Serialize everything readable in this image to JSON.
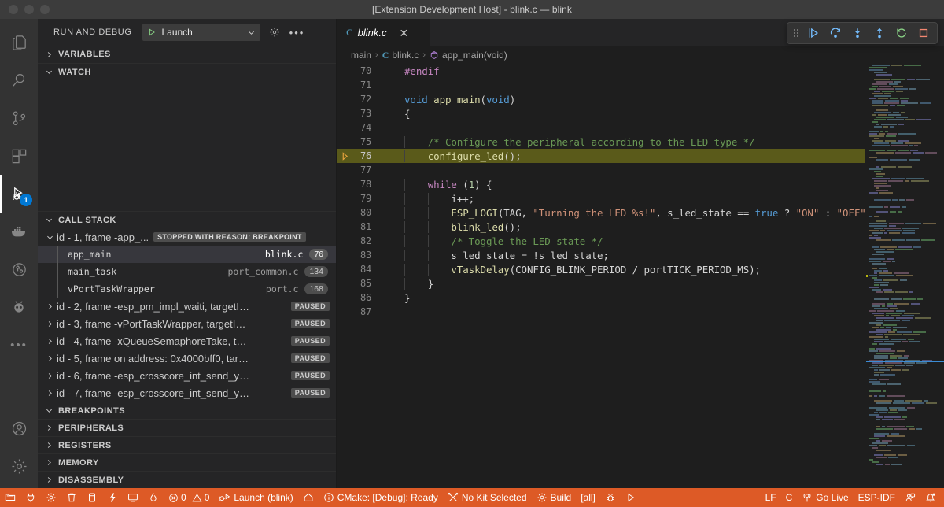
{
  "window": {
    "title": "[Extension Development Host] - blink.c — blink",
    "traffic_lights": [
      "close",
      "minimize",
      "zoom"
    ]
  },
  "activity_bar": {
    "items": [
      {
        "name": "explorer",
        "icon": "files-icon",
        "active": false
      },
      {
        "name": "search",
        "icon": "search-icon",
        "active": false
      },
      {
        "name": "source-control",
        "icon": "source-control-icon",
        "active": false
      },
      {
        "name": "extensions",
        "icon": "extensions-icon",
        "active": false
      },
      {
        "name": "run-and-debug",
        "icon": "debug-icon",
        "active": true,
        "badge": "1"
      },
      {
        "name": "docker",
        "icon": "docker-icon",
        "active": false
      },
      {
        "name": "testing",
        "icon": "beaker-icon",
        "active": false
      },
      {
        "name": "espressif",
        "icon": "ant-icon",
        "active": false
      },
      {
        "name": "more-views",
        "icon": "ellipsis-icon",
        "active": false
      }
    ],
    "bottom_items": [
      {
        "name": "accounts",
        "icon": "account-icon"
      },
      {
        "name": "manage",
        "icon": "gear-icon"
      }
    ]
  },
  "sidebar": {
    "header": {
      "title": "RUN AND DEBUG",
      "launch_config": "Launch",
      "play_icon": "play-icon",
      "chevron_icon": "chevron-down-icon",
      "settings_icon": "gear-icon",
      "more_icon": "ellipsis-icon"
    },
    "sections": [
      {
        "name": "variables",
        "label": "VARIABLES",
        "expanded": false
      },
      {
        "name": "watch",
        "label": "WATCH",
        "expanded": true
      },
      {
        "name": "call-stack",
        "label": "CALL STACK",
        "expanded": true
      }
    ],
    "bottom_sections": [
      {
        "name": "breakpoints",
        "label": "BREAKPOINTS",
        "expanded": true
      },
      {
        "name": "peripherals",
        "label": "PERIPHERALS",
        "expanded": false
      },
      {
        "name": "registers",
        "label": "REGISTERS",
        "expanded": false
      },
      {
        "name": "memory",
        "label": "MEMORY",
        "expanded": false
      },
      {
        "name": "disassembly",
        "label": "DISASSEMBLY",
        "expanded": false
      }
    ],
    "call_stack": {
      "threads": [
        {
          "label": "id - 1, frame -app_...",
          "expanded": true,
          "badge": "STOPPED WITH REASON: BREAKPOINT",
          "frames": [
            {
              "name": "app_main",
              "file": "blink.c",
              "line": "76",
              "selected": true
            },
            {
              "name": "main_task",
              "file": "port_common.c",
              "line": "134",
              "selected": false
            },
            {
              "name": "vPortTaskWrapper",
              "file": "port.c",
              "line": "168",
              "selected": false
            }
          ]
        },
        {
          "label": "id - 2, frame -esp_pm_impl_waiti, targetID - ...",
          "expanded": false,
          "badge": "PAUSED",
          "frames": []
        },
        {
          "label": "id - 3, frame -vPortTaskWrapper, targetID - ...",
          "expanded": false,
          "badge": "PAUSED",
          "frames": []
        },
        {
          "label": "id - 4, frame -xQueueSemaphoreTake, target...",
          "expanded": false,
          "badge": "PAUSED",
          "frames": []
        },
        {
          "label": "id - 5, frame on address: 0x4000bff0, target...",
          "expanded": false,
          "badge": "PAUSED",
          "frames": []
        },
        {
          "label": "id - 6, frame -esp_crosscore_int_send_yield, ...",
          "expanded": false,
          "badge": "PAUSED",
          "frames": []
        },
        {
          "label": "id - 7, frame -esp_crosscore_int_send_yield, t...",
          "expanded": false,
          "badge": "PAUSED",
          "frames": []
        }
      ]
    }
  },
  "editor": {
    "tab": {
      "lang_badge": "C",
      "name": "blink.c",
      "close_icon": "close-icon",
      "dirty": false
    },
    "breadcrumb": [
      {
        "label": "main",
        "icon": ""
      },
      {
        "label": "blink.c",
        "icon": "c-file-icon"
      },
      {
        "label": "app_main(void)",
        "icon": "symbol-method-icon"
      }
    ],
    "debug_toolbar": [
      {
        "name": "drag-handle",
        "icon": "grip-icon",
        "color": "#8a8a8a"
      },
      {
        "name": "continue",
        "icon": "continue-icon",
        "color": "#75beff"
      },
      {
        "name": "step-over",
        "icon": "step-over-icon",
        "color": "#75beff"
      },
      {
        "name": "step-into",
        "icon": "step-into-icon",
        "color": "#75beff"
      },
      {
        "name": "step-out",
        "icon": "step-out-icon",
        "color": "#75beff"
      },
      {
        "name": "restart",
        "icon": "restart-icon",
        "color": "#89d185"
      },
      {
        "name": "stop",
        "icon": "stop-icon",
        "color": "#f48771"
      }
    ],
    "breakpoint_line": 76,
    "current_line": 76,
    "first_line": 70,
    "lines": [
      {
        "no": 70,
        "indent": 0,
        "tokens": [
          {
            "t": "#endif",
            "c": "tk-pp"
          }
        ]
      },
      {
        "no": 71,
        "indent": 0,
        "tokens": []
      },
      {
        "no": 72,
        "indent": 0,
        "tokens": [
          {
            "t": "void",
            "c": "tk-type"
          },
          {
            "t": " ",
            "c": "tk-pl"
          },
          {
            "t": "app_main",
            "c": "tk-fn"
          },
          {
            "t": "(",
            "c": "tk-pl"
          },
          {
            "t": "void",
            "c": "tk-type"
          },
          {
            "t": ")",
            "c": "tk-pl"
          }
        ]
      },
      {
        "no": 73,
        "indent": 0,
        "tokens": [
          {
            "t": "{",
            "c": "tk-pl"
          }
        ]
      },
      {
        "no": 74,
        "indent": 1,
        "tokens": []
      },
      {
        "no": 75,
        "indent": 1,
        "tokens": [
          {
            "t": "    /* Configure the peripheral according to the LED type */",
            "c": "tk-cm"
          }
        ]
      },
      {
        "no": 76,
        "indent": 1,
        "tokens": [
          {
            "t": "    ",
            "c": "tk-pl"
          },
          {
            "t": "configure_led",
            "c": "tk-fn"
          },
          {
            "t": "();",
            "c": "tk-pl"
          }
        ]
      },
      {
        "no": 77,
        "indent": 1,
        "tokens": []
      },
      {
        "no": 78,
        "indent": 1,
        "tokens": [
          {
            "t": "    ",
            "c": "tk-pl"
          },
          {
            "t": "while",
            "c": "tk-kw"
          },
          {
            "t": " (",
            "c": "tk-pl"
          },
          {
            "t": "1",
            "c": "tk-num"
          },
          {
            "t": ") {",
            "c": "tk-pl"
          }
        ]
      },
      {
        "no": 79,
        "indent": 2,
        "tokens": [
          {
            "t": "        i++;",
            "c": "tk-pl"
          }
        ]
      },
      {
        "no": 80,
        "indent": 2,
        "tokens": [
          {
            "t": "        ",
            "c": "tk-pl"
          },
          {
            "t": "ESP_LOGI",
            "c": "tk-fn"
          },
          {
            "t": "(TAG, ",
            "c": "tk-pl"
          },
          {
            "t": "\"Turning the LED %s!\"",
            "c": "tk-str"
          },
          {
            "t": ", s_led_state == ",
            "c": "tk-pl"
          },
          {
            "t": "true",
            "c": "tk-type"
          },
          {
            "t": " ? ",
            "c": "tk-pl"
          },
          {
            "t": "\"ON\"",
            "c": "tk-str"
          },
          {
            "t": " : ",
            "c": "tk-pl"
          },
          {
            "t": "\"OFF\"",
            "c": "tk-str"
          },
          {
            "t": ");",
            "c": "tk-pl"
          }
        ]
      },
      {
        "no": 81,
        "indent": 2,
        "tokens": [
          {
            "t": "        ",
            "c": "tk-pl"
          },
          {
            "t": "blink_led",
            "c": "tk-fn"
          },
          {
            "t": "();",
            "c": "tk-pl"
          }
        ]
      },
      {
        "no": 82,
        "indent": 2,
        "tokens": [
          {
            "t": "        /* Toggle the LED state */",
            "c": "tk-cm"
          }
        ]
      },
      {
        "no": 83,
        "indent": 2,
        "tokens": [
          {
            "t": "        s_led_state = !s_led_state;",
            "c": "tk-pl"
          }
        ]
      },
      {
        "no": 84,
        "indent": 2,
        "tokens": [
          {
            "t": "        ",
            "c": "tk-pl"
          },
          {
            "t": "vTaskDelay",
            "c": "tk-fn"
          },
          {
            "t": "(CONFIG_BLINK_PERIOD / portTICK_PERIOD_MS);",
            "c": "tk-pl"
          }
        ]
      },
      {
        "no": 85,
        "indent": 1,
        "tokens": [
          {
            "t": "    }",
            "c": "tk-pl"
          }
        ]
      },
      {
        "no": 86,
        "indent": 0,
        "tokens": [
          {
            "t": "}",
            "c": "tk-pl"
          }
        ]
      },
      {
        "no": 87,
        "indent": 0,
        "tokens": []
      }
    ]
  },
  "status_bar": {
    "background": "#dd5a26",
    "left": [
      {
        "name": "esp-idf-open-project",
        "icon": "folder-icon",
        "label": ""
      },
      {
        "name": "esp-idf-select-port",
        "icon": "plug-icon",
        "label": ""
      },
      {
        "name": "esp-idf-menuconfig",
        "icon": "gear-icon",
        "label": ""
      },
      {
        "name": "esp-idf-full-clean",
        "icon": "trash-icon",
        "label": ""
      },
      {
        "name": "esp-idf-build",
        "icon": "database-icon",
        "label": ""
      },
      {
        "name": "esp-idf-flash",
        "icon": "zap-icon",
        "label": ""
      },
      {
        "name": "esp-idf-monitor",
        "icon": "monitor-icon",
        "label": ""
      },
      {
        "name": "esp-idf-build-flash-monitor",
        "icon": "flame-icon",
        "label": ""
      },
      {
        "name": "problems",
        "icon": "error-warning-icon",
        "label": "0  0",
        "errors": "0",
        "warnings": "0"
      },
      {
        "name": "launch-target",
        "icon": "debug-alt-icon",
        "label": "Launch (blink)"
      },
      {
        "name": "home",
        "icon": "home-icon",
        "label": ""
      },
      {
        "name": "cmake-status",
        "icon": "info-icon",
        "label": "CMake: [Debug]: Ready"
      },
      {
        "name": "cmake-kit",
        "icon": "tools-icon",
        "label": "No Kit Selected"
      },
      {
        "name": "cmake-build",
        "icon": "gear-icon",
        "label": "Build"
      },
      {
        "name": "cmake-build-target",
        "icon": "",
        "label": "[all]"
      },
      {
        "name": "cmake-debug",
        "icon": "bug-icon",
        "label": ""
      },
      {
        "name": "cmake-run",
        "icon": "play-icon",
        "label": ""
      }
    ],
    "right": [
      {
        "name": "eol-selector",
        "icon": "",
        "label": "LF"
      },
      {
        "name": "language-mode",
        "icon": "",
        "label": "C"
      },
      {
        "name": "go-live",
        "icon": "broadcast-icon",
        "label": "Go Live"
      },
      {
        "name": "esp-idf-version",
        "icon": "",
        "label": "ESP-IDF"
      },
      {
        "name": "live-share",
        "icon": "live-share-icon",
        "label": ""
      },
      {
        "name": "notifications",
        "icon": "bell-dot-icon",
        "label": ""
      }
    ]
  },
  "colors": {
    "accent_blue": "#0078d4",
    "status_bar": "#dd5a26",
    "current_line": "#5a5a1a",
    "breakpoint": "#e8a33d",
    "selection": "#37373d"
  }
}
